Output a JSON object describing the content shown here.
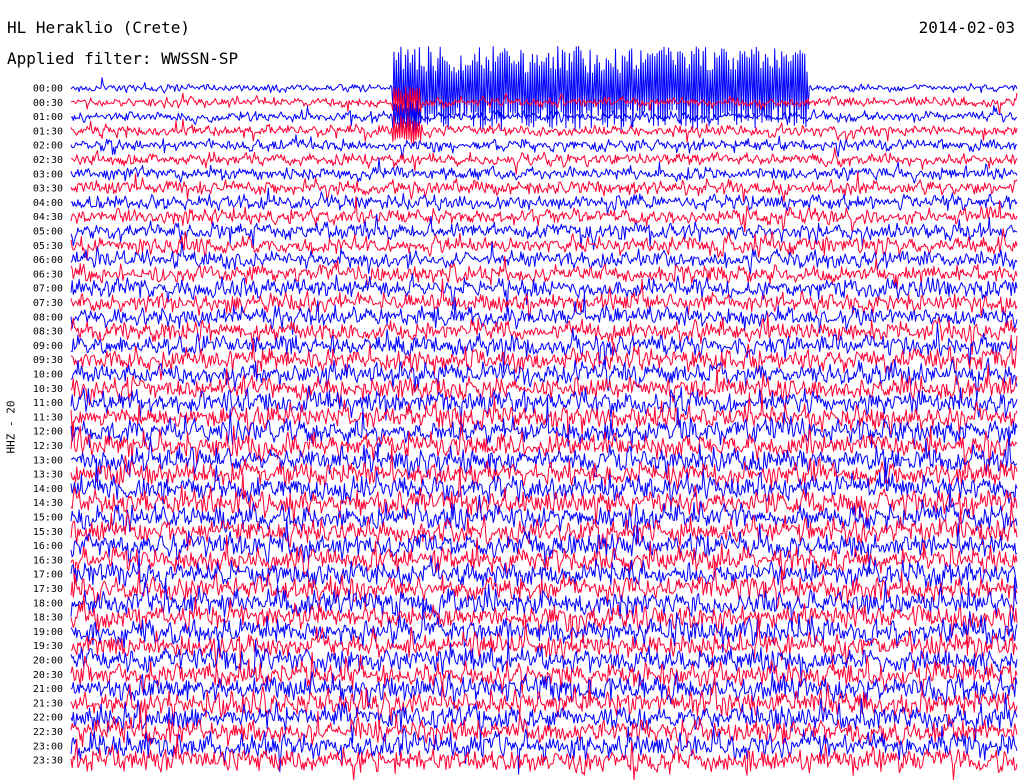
{
  "header": {
    "station": "HL Heraklio (Crete)",
    "filter": "Applied filter: WWSSN-SP",
    "date": "2014-02-03"
  },
  "channel_label": "HHZ - 20",
  "colors": {
    "trace_a": "#0000ff",
    "trace_b": "#ff0033",
    "text": "#000000",
    "background": "#ffffff"
  },
  "chart_data": {
    "type": "line",
    "title": "HL Heraklio (Crete)",
    "xlabel": "",
    "ylabel": "HHZ - 20",
    "row_interval_minutes": 30,
    "rows": [
      "00:00",
      "00:30",
      "01:00",
      "01:30",
      "02:00",
      "02:30",
      "03:00",
      "03:30",
      "04:00",
      "04:30",
      "05:00",
      "05:30",
      "06:00",
      "06:30",
      "07:00",
      "07:30",
      "08:00",
      "08:30",
      "09:00",
      "09:30",
      "10:00",
      "10:30",
      "11:00",
      "11:30",
      "12:00",
      "12:30",
      "13:00",
      "13:30",
      "14:00",
      "14:30",
      "15:00",
      "15:30",
      "16:00",
      "16:30",
      "17:00",
      "17:30",
      "18:00",
      "18:30",
      "19:00",
      "19:30",
      "20:00",
      "20:30",
      "21:00",
      "21:30",
      "22:00",
      "22:30",
      "23:00",
      "23:30"
    ],
    "trace_colors": [
      "#0000ff",
      "#ff0033"
    ],
    "relative_amplitude": [
      0.3,
      0.4,
      0.42,
      0.45,
      0.48,
      0.5,
      0.55,
      0.58,
      0.6,
      0.62,
      0.66,
      0.68,
      0.7,
      0.72,
      0.75,
      0.78,
      0.8,
      0.84,
      0.85,
      0.88,
      0.9,
      0.92,
      0.94,
      0.96,
      1.0,
      1.0,
      1.0,
      1.0,
      1.0,
      1.0,
      1.0,
      1.0,
      1.0,
      1.0,
      1.0,
      1.0,
      1.0,
      1.0,
      1.0,
      1.0,
      1.0,
      1.0,
      1.0,
      1.0,
      1.0,
      1.0,
      1.0,
      0.95
    ],
    "events": [
      {
        "row": 0,
        "start_fraction": 0.34,
        "end_fraction": 0.78,
        "peak_relative": 10,
        "note": "large spike train clipped above first trace"
      },
      {
        "row": 1,
        "start_fraction": 0.34,
        "end_fraction": 0.37,
        "peak_relative": 3
      },
      {
        "row": 2,
        "start_fraction": 0.34,
        "end_fraction": 0.37,
        "peak_relative": 3
      },
      {
        "row": 3,
        "start_fraction": 0.34,
        "end_fraction": 0.37,
        "peak_relative": 2.5
      }
    ]
  }
}
